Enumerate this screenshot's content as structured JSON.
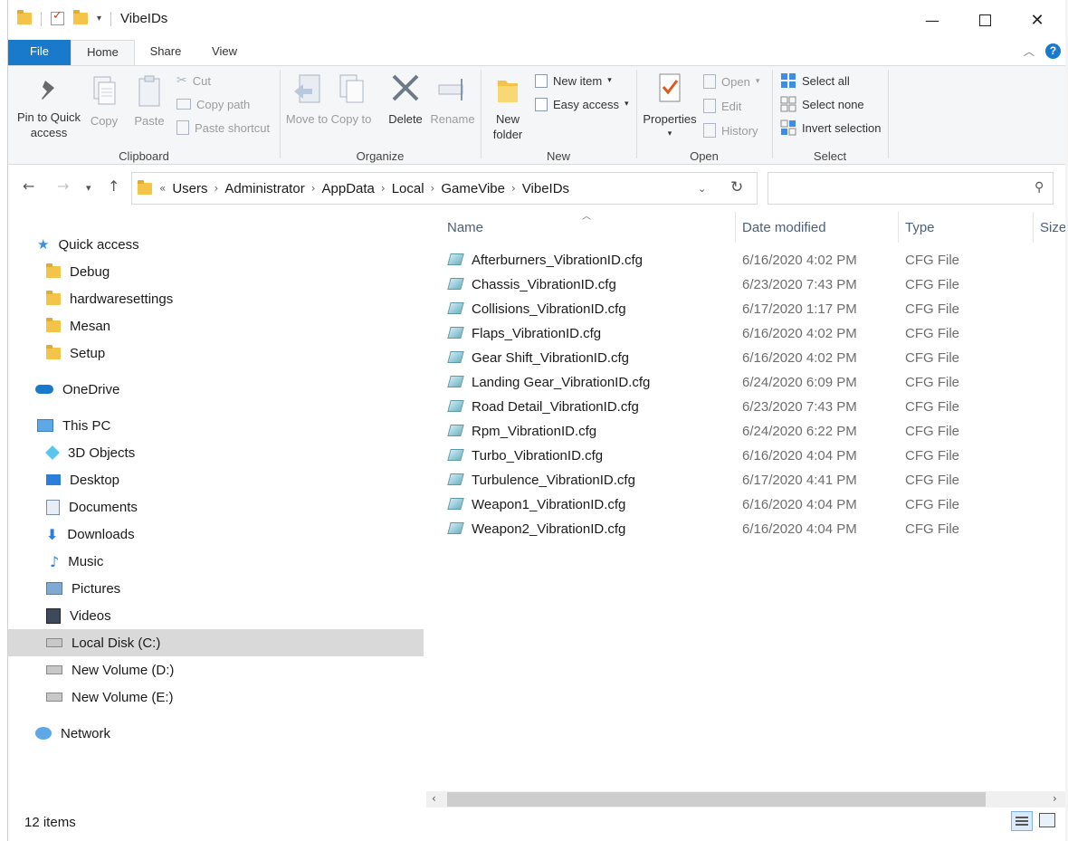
{
  "window": {
    "title": "VibeIDs"
  },
  "tabs": [
    "File",
    "Home",
    "Share",
    "View"
  ],
  "ribbon": {
    "clipboard": {
      "label": "Clipboard",
      "pin": "Pin to Quick access",
      "copy": "Copy",
      "paste": "Paste",
      "cut": "Cut",
      "copy_path": "Copy path",
      "paste_shortcut": "Paste shortcut"
    },
    "organize": {
      "label": "Organize",
      "move_to": "Move to",
      "copy_to": "Copy to",
      "delete": "Delete",
      "rename": "Rename"
    },
    "new": {
      "label": "New",
      "new_folder": "New folder",
      "new_item": "New item",
      "easy_access": "Easy access"
    },
    "open": {
      "label": "Open",
      "properties": "Properties",
      "open": "Open",
      "edit": "Edit",
      "history": "History"
    },
    "select": {
      "label": "Select",
      "select_all": "Select all",
      "select_none": "Select none",
      "invert": "Invert selection"
    }
  },
  "address": {
    "overflow": "«",
    "crumbs": [
      "Users",
      "Administrator",
      "AppData",
      "Local",
      "GameVibe",
      "VibeIDs"
    ]
  },
  "nav": {
    "quick_access": "Quick access",
    "quick_items": [
      "Debug",
      "hardwaresettings",
      "Mesan",
      "Setup"
    ],
    "onedrive": "OneDrive",
    "this_pc": "This PC",
    "pc_items": [
      "3D Objects",
      "Desktop",
      "Documents",
      "Downloads",
      "Music",
      "Pictures",
      "Videos",
      "Local Disk (C:)",
      "New Volume (D:)",
      "New Volume (E:)"
    ],
    "network": "Network"
  },
  "columns": {
    "name": "Name",
    "date": "Date modified",
    "type": "Type",
    "size": "Size"
  },
  "files": [
    {
      "name": "Afterburners_VibrationID.cfg",
      "date": "6/16/2020 4:02 PM",
      "type": "CFG File"
    },
    {
      "name": "Chassis_VibrationID.cfg",
      "date": "6/23/2020 7:43 PM",
      "type": "CFG File"
    },
    {
      "name": "Collisions_VibrationID.cfg",
      "date": "6/17/2020 1:17 PM",
      "type": "CFG File"
    },
    {
      "name": "Flaps_VibrationID.cfg",
      "date": "6/16/2020 4:02 PM",
      "type": "CFG File"
    },
    {
      "name": "Gear Shift_VibrationID.cfg",
      "date": "6/16/2020 4:02 PM",
      "type": "CFG File"
    },
    {
      "name": "Landing Gear_VibrationID.cfg",
      "date": "6/24/2020 6:09 PM",
      "type": "CFG File"
    },
    {
      "name": "Road Detail_VibrationID.cfg",
      "date": "6/23/2020 7:43 PM",
      "type": "CFG File"
    },
    {
      "name": "Rpm_VibrationID.cfg",
      "date": "6/24/2020 6:22 PM",
      "type": "CFG File"
    },
    {
      "name": "Turbo_VibrationID.cfg",
      "date": "6/16/2020 4:04 PM",
      "type": "CFG File"
    },
    {
      "name": "Turbulence_VibrationID.cfg",
      "date": "6/17/2020 4:41 PM",
      "type": "CFG File"
    },
    {
      "name": "Weapon1_VibrationID.cfg",
      "date": "6/16/2020 4:04 PM",
      "type": "CFG File"
    },
    {
      "name": "Weapon2_VibrationID.cfg",
      "date": "6/16/2020 4:04 PM",
      "type": "CFG File"
    }
  ],
  "status": {
    "count": "12 items"
  },
  "colors": {
    "accent": "#1979ca",
    "selected_nav": "#d9d9d9"
  }
}
